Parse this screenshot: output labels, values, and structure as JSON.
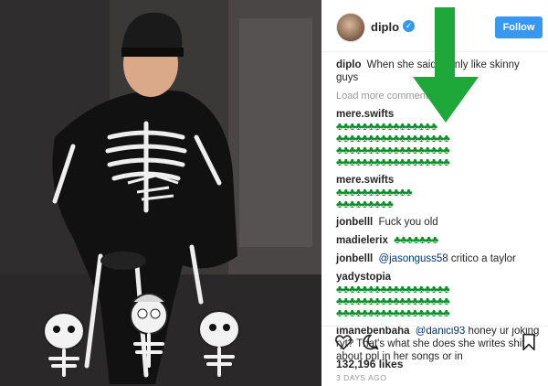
{
  "post": {
    "username": "diplo",
    "verified_glyph": "✓",
    "follow_label": "Follow",
    "caption_user": "diplo",
    "caption_text": "When she said \"I only like skinny guys",
    "load_more": "Load more comments",
    "likes": "132,196 likes",
    "date": "3 DAYS AGO"
  },
  "comments": [
    {
      "user": "mere.swifts",
      "text": "",
      "emoji_lines": [
        "♣♣♣♣♣♣♣♣♣♣♣♣♣♣♣♣",
        "♣♣♣♣♣♣♣♣♣♣♣♣♣♣♣♣♣♣",
        "♣♣♣♣♣♣♣♣♣♣♣♣♣♣♣♣♣♣",
        "♣♣♣♣♣♣♣♣♣♣♣♣♣♣♣♣♣♣"
      ]
    },
    {
      "user": "mere.swifts",
      "text": "",
      "emoji_lines": [
        "♣♣♣♣♣♣♣♣♣♣♣♣",
        "♣♣♣♣♣♣♣♣♣"
      ]
    },
    {
      "user": "jonbelll",
      "text": "Fuck you old",
      "emoji_lines": []
    },
    {
      "user": "madielerix",
      "text": "",
      "emoji_lines": [
        "♣♣♣♣♣♣♣"
      ]
    },
    {
      "user": "jonbelll",
      "mention": "@jasonguss58",
      "text": "critico a taylor",
      "emoji_lines": []
    },
    {
      "user": "yadystopia",
      "text": "",
      "emoji_lines": [
        "♣♣♣♣♣♣♣♣♣♣♣♣♣♣♣♣♣♣",
        "♣♣♣♣♣♣♣♣♣♣♣♣♣♣♣♣♣♣",
        "♣♣♣♣♣♣♣♣♣♣♣♣♣♣♣♣♣♣"
      ]
    },
    {
      "user": "imanebenbaha",
      "mention": "@danici93",
      "text": "honey ur joking ryt? That's what she does she writes shit about ppl in her songs or in",
      "emoji_lines": []
    }
  ],
  "colors": {
    "accent": "#3897f0",
    "arrow": "#1fa83a",
    "emoji": "#0a8f28"
  },
  "icons": {
    "like": "heart-icon",
    "comment": "comment-icon",
    "save": "bookmark-icon",
    "verified": "verified-badge-icon"
  }
}
